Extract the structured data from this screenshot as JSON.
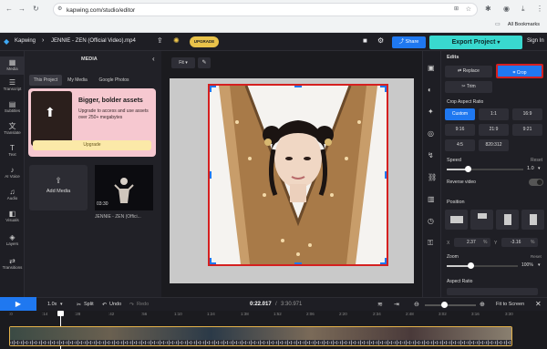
{
  "browser": {
    "url": "kapwing.com/studio/editor",
    "bookmarks_label": "All Bookmarks"
  },
  "header": {
    "brand": "Kapwing",
    "project_title": "JENNIE - ZEN (Official Video).mp4",
    "upgrade_label": "UPGRADE",
    "share_label": "Share",
    "export_label": "Export Project",
    "signin_label": "Sign In"
  },
  "toolbar": {
    "items": [
      {
        "label": "Media",
        "icon": "media-icon"
      },
      {
        "label": "Transcript",
        "icon": "transcript-icon"
      },
      {
        "label": "Subtitles",
        "icon": "subtitles-icon"
      },
      {
        "label": "Translate",
        "icon": "translate-icon"
      },
      {
        "label": "Text",
        "icon": "text-icon"
      },
      {
        "label": "AI Voice",
        "icon": "ai-voice-icon"
      },
      {
        "label": "Audio",
        "icon": "audio-icon"
      },
      {
        "label": "Visuals",
        "icon": "visuals-icon"
      },
      {
        "label": "Layers",
        "icon": "layers-icon"
      },
      {
        "label": "Transitions",
        "icon": "transitions-icon"
      }
    ]
  },
  "media": {
    "title": "MEDIA",
    "tabs": [
      "This Project",
      "My Media",
      "Google Photos"
    ],
    "promo_title": "Bigger, bolder assets",
    "promo_text": "Upgrade to access and use assets over 250+ megabytes",
    "promo_button": "Upgrade",
    "add_media": "Add Media",
    "clip_duration": "03:30",
    "clip_name": "JENNIE - ZEN (Offici..."
  },
  "canvas": {
    "fit_label": "Fit"
  },
  "edits": {
    "title": "Edits",
    "replace": "Replace",
    "crop": "Crop",
    "trim": "Trim",
    "crop_ratio_label": "Crop Aspect Ratio",
    "ratios": [
      "Custom",
      "1:1",
      "16:9",
      "9:16",
      "21:9",
      "9:21",
      "4:5",
      "820:312"
    ],
    "speed_label": "Speed",
    "speed_reset": "Reset",
    "speed_value": "1.0",
    "speed_fraction": 0.27,
    "reverse_label": "Reverse video",
    "position_label": "Position",
    "x_label": "X",
    "x_value": "2.37",
    "y_label": "Y",
    "y_value": "-3.16",
    "unit": "%",
    "zoom_label": "Zoom",
    "zoom_reset": "Reset",
    "zoom_value": "100%",
    "zoom_fraction": 0.33,
    "aspect_label": "Aspect Ratio"
  },
  "controls": {
    "speed": "1.0x",
    "split": "Split",
    "undo": "Undo",
    "redo": "Redo",
    "current_time": "0:22.017",
    "total_time": "3:30.971",
    "fit_screen": "Fit to Screen"
  },
  "timeline": {
    "ticks": [
      ":0",
      ":14",
      ":28",
      ":42",
      ":56",
      "1:10",
      "1:24",
      "1:38",
      "1:52",
      "2:06",
      "2:20",
      "2:34",
      "2:48",
      "3:02",
      "3:16",
      "3:30"
    ]
  },
  "colors": {
    "accent": "#1f78f0",
    "export": "#39d9cf",
    "upgrade": "#e9c24a",
    "highlight": "#d52020"
  }
}
